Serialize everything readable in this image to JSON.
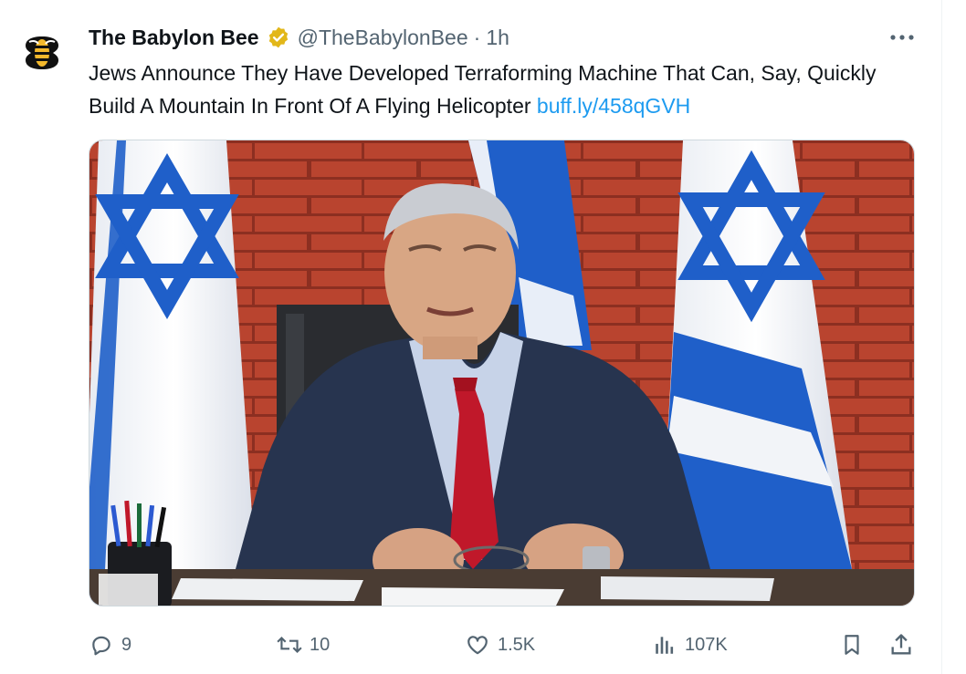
{
  "tweet": {
    "author_name": "The Babylon Bee",
    "handle": "@TheBabylonBee",
    "separator": "·",
    "time": "1h",
    "text": "Jews Announce They Have Developed Terraforming Machine That Can, Say, Quickly Build A Mountain In Front Of A Flying Helicopter ",
    "link": "buff.ly/458qGVH"
  },
  "actions": {
    "replies": "9",
    "reposts": "10",
    "likes": "1.5K",
    "views": "107K"
  },
  "colors": {
    "link": "#1d9bf0",
    "muted": "#536471",
    "verified_gold": "#e2b719",
    "flag_blue": "#1f5fc9",
    "brick": "#b8412e"
  },
  "icons": {
    "avatar": "babylon-bee-logo",
    "verified": "verified-badge-icon",
    "more": "more-icon",
    "reply": "reply-icon",
    "repost": "repost-icon",
    "like": "heart-icon",
    "views": "views-icon",
    "bookmark": "bookmark-icon",
    "share": "share-icon"
  }
}
